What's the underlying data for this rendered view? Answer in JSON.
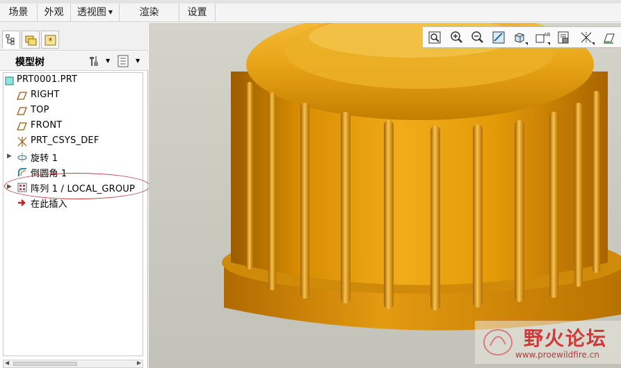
{
  "menu": {
    "items": [
      {
        "label": "场景",
        "has_dropdown": false
      },
      {
        "label": "外观",
        "has_dropdown": false
      },
      {
        "label": "透视图",
        "has_dropdown": true
      },
      {
        "label": "渲染",
        "has_dropdown": false
      },
      {
        "label": "设置",
        "has_dropdown": false
      }
    ]
  },
  "panel": {
    "tabs": [
      "model-tree-tab",
      "folder-browser-tab",
      "favorites-tab"
    ],
    "tree_title": "模型树"
  },
  "tree": {
    "items": [
      {
        "label": "PRT0001.PRT",
        "icon": "part-icon",
        "expander": false
      },
      {
        "label": "RIGHT",
        "icon": "datum-plane-icon",
        "expander": false
      },
      {
        "label": "TOP",
        "icon": "datum-plane-icon",
        "expander": false
      },
      {
        "label": "FRONT",
        "icon": "datum-plane-icon",
        "expander": false
      },
      {
        "label": "PRT_CSYS_DEF",
        "icon": "coordinate-system-icon",
        "expander": false
      },
      {
        "label": "旋转 1",
        "icon": "revolve-icon",
        "expander": true
      },
      {
        "label": "倒圆角 1",
        "icon": "round-icon",
        "expander": false
      },
      {
        "label": "阵列 1 / LOCAL_GROUP",
        "icon": "pattern-icon",
        "expander": true
      },
      {
        "label": "在此插入",
        "icon": "insert-here-arrow-icon",
        "expander": false
      }
    ]
  },
  "view_toolbar": {
    "buttons": [
      "refit-icon",
      "zoom-in-icon",
      "zoom-out-icon",
      "repaint-icon",
      "shading-icon",
      "named-views-icon",
      "saved-orientations-icon",
      "datum-display-icon",
      "annotation-display-icon"
    ]
  },
  "watermark": {
    "text": "野火论坛",
    "url": "www.proewildfire.cn"
  },
  "colors": {
    "accent_gold": "#e0a018",
    "highlight_red": "#c23a3a",
    "viewport_bg": "#cbcbc1"
  }
}
